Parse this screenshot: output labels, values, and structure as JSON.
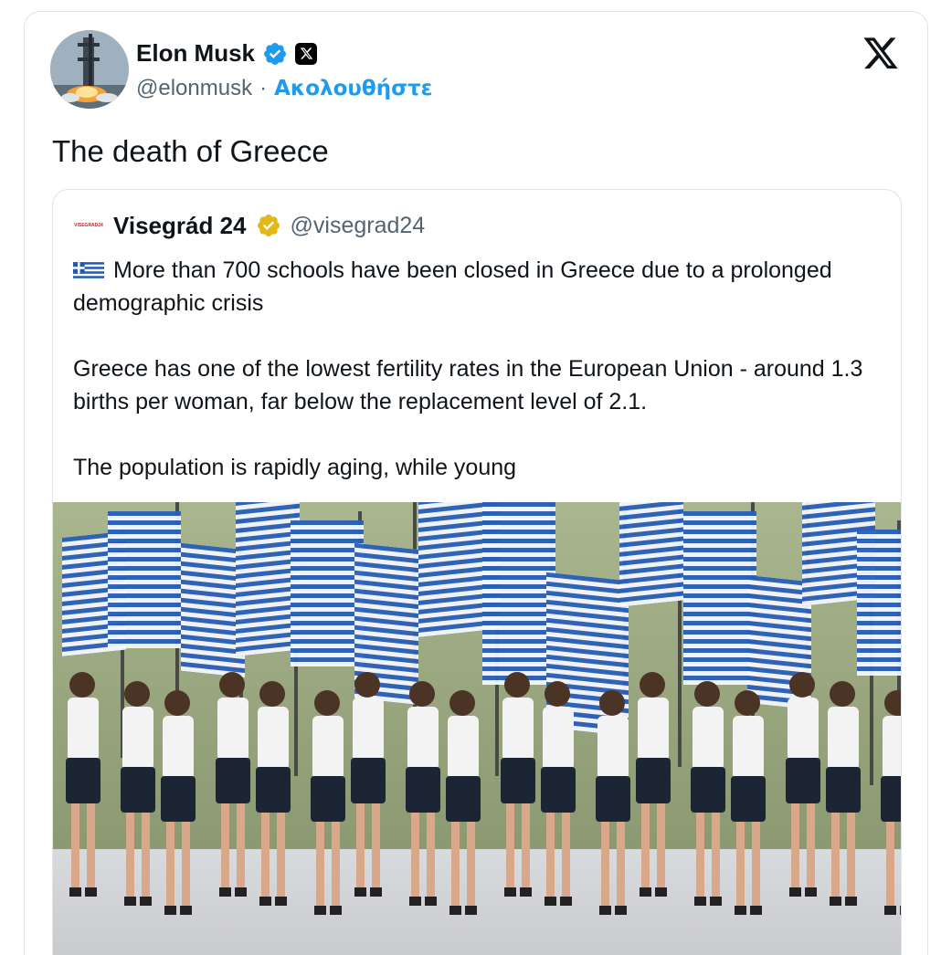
{
  "author": {
    "name": "Elon Musk",
    "handle": "@elonmusk",
    "separator": "·",
    "follow_label": "Ακολουθήστε"
  },
  "tweet": {
    "text": "The death of Greece"
  },
  "quoted": {
    "logo_text": "VISEGRAD24",
    "name": "Visegrád 24",
    "handle": "@visegrad24",
    "paragraph1": "More than 700 schools have been closed in Greece due to a prolonged demographic crisis",
    "paragraph2": "Greece has one of the lowest fertility rates in the European Union - around 1.3 births per woman, far below the replacement level of 2.1.",
    "paragraph3": "The population is rapidly aging, while young"
  },
  "colors": {
    "accent": "#1d9bf0",
    "gold_badge": "#e2b719",
    "greek_blue": "#1f5bb5",
    "text": "#0f1419",
    "muted": "#536471"
  },
  "icons": {
    "verified": "verified-badge-icon",
    "x_affiliate": "x-affiliate-icon",
    "x_logo": "x-logo-icon",
    "flag": "greece-flag-icon"
  }
}
